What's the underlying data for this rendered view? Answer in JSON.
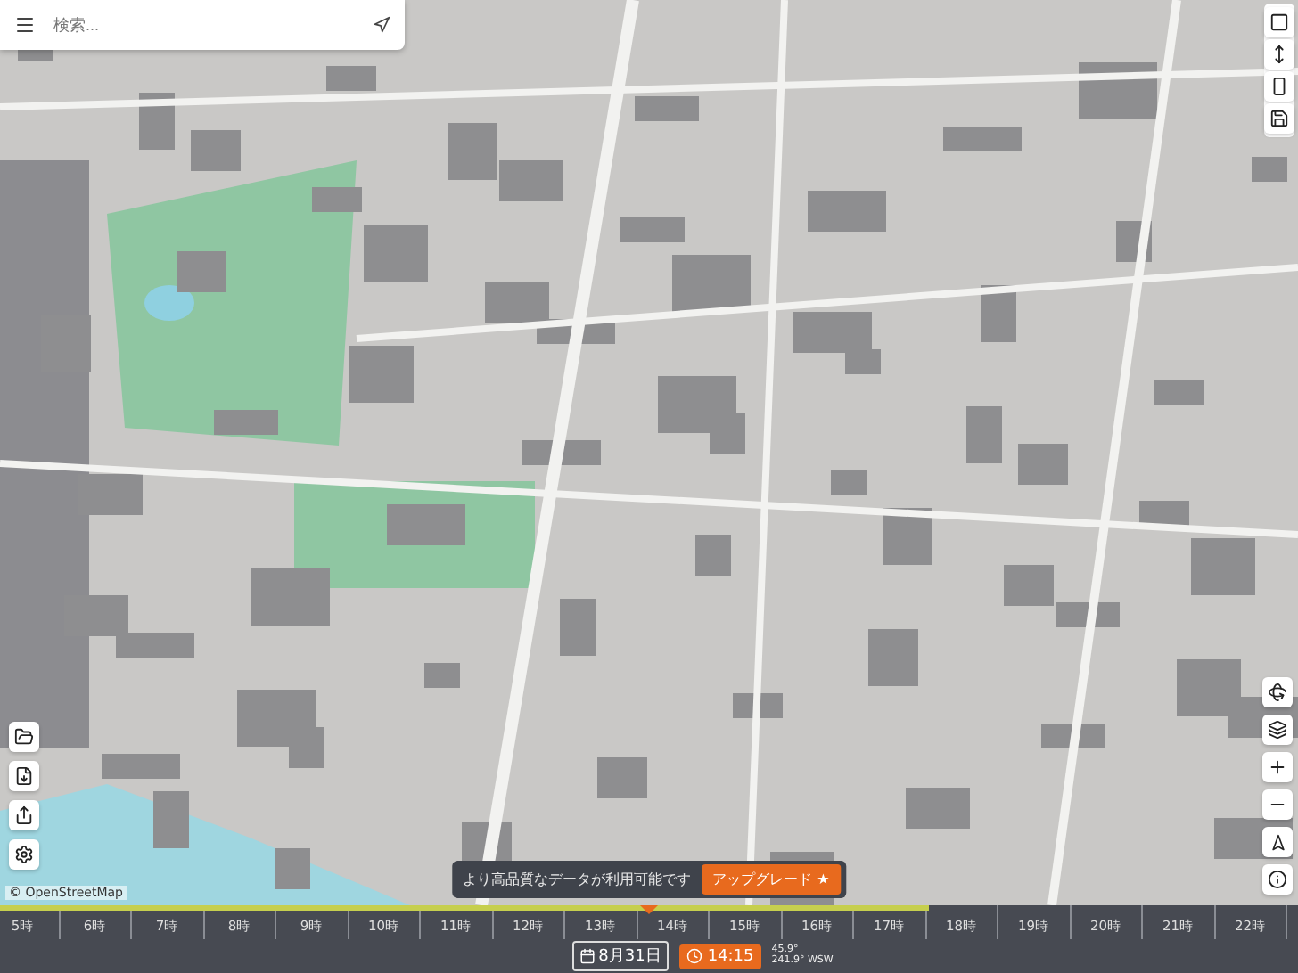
{
  "search": {
    "placeholder": "検索..."
  },
  "attribution": "© OpenStreetMap",
  "banner": {
    "message": "より高品質なデータが利用可能です",
    "button": "アップグレード ★"
  },
  "timeline": {
    "hours": [
      "5時",
      "6時",
      "7時",
      "8時",
      "9時",
      "10時",
      "11時",
      "12時",
      "13時",
      "14時",
      "15時",
      "16時",
      "17時",
      "18時",
      "19時",
      "20時",
      "21時",
      "22時"
    ],
    "daylight": {
      "level": 0.715
    },
    "cursor": {
      "level": 0.5
    }
  },
  "bottom_bar": {
    "date": "8月31日",
    "time": "14:15",
    "elevation": "45.9°",
    "azimuth": "241.9° WSW"
  }
}
